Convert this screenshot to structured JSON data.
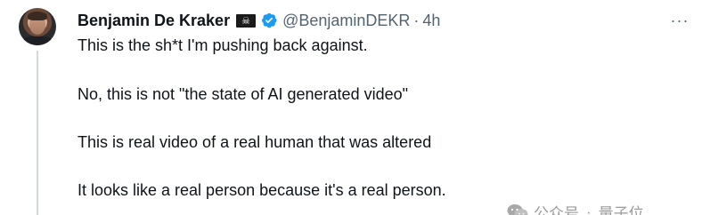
{
  "author": {
    "name": "Benjamin De Kraker",
    "flag_glyph": "☠",
    "handle": "@BenjaminDEKR",
    "separator": "·",
    "time": "4h"
  },
  "menu": {
    "more_glyph": "···"
  },
  "tweet": {
    "paragraphs": [
      "This is the sh*t I'm pushing back against.",
      "No, this is not \"the state of AI generated video\"",
      "This is real video of a real human that was altered",
      "It looks like a real person because it's a real person."
    ]
  },
  "watermark": {
    "account": "公众号",
    "separator": "·",
    "name": "量子位"
  },
  "colors": {
    "text": "#0f1419",
    "secondary": "#536471",
    "verified": "#1d9bf0",
    "thread_line": "#cfd9de"
  },
  "icons": {
    "verified": "verified-badge-icon",
    "more": "more-horizontal-icon",
    "watermark": "wechat-icon"
  }
}
